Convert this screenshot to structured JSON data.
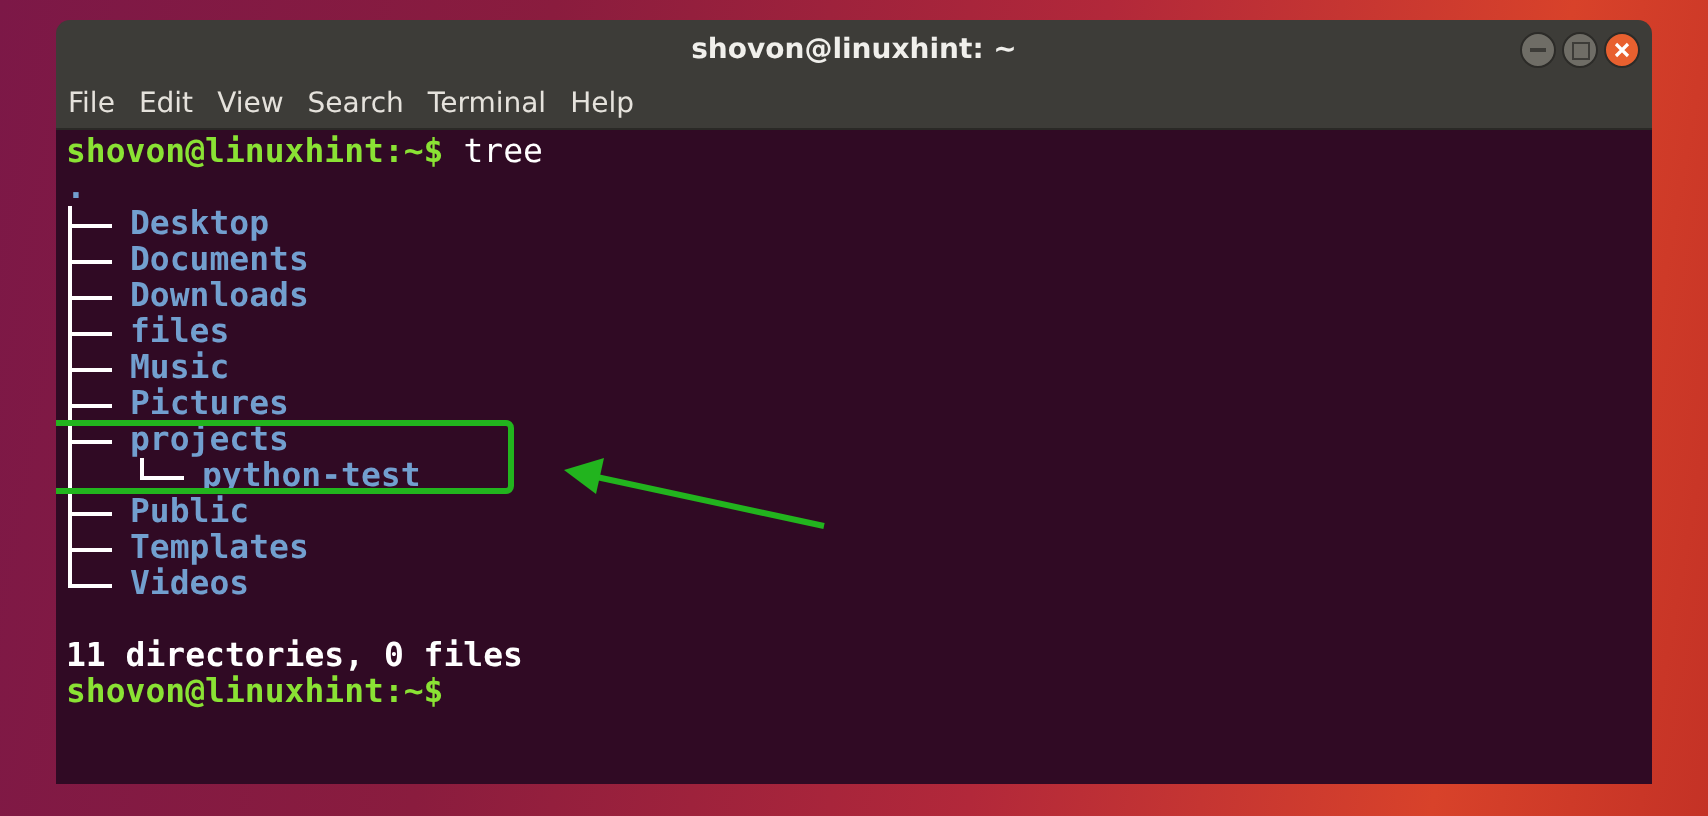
{
  "window": {
    "title": "shovon@linuxhint: ~"
  },
  "menu": [
    "File",
    "Edit",
    "View",
    "Search",
    "Terminal",
    "Help"
  ],
  "terminal": {
    "command_line": {
      "prompt": "shovon@linuxhint:~$",
      "command": "tree"
    },
    "tree": {
      "root": ".",
      "children": [
        {
          "name": "Desktop",
          "highlighted": false
        },
        {
          "name": "Documents",
          "highlighted": false
        },
        {
          "name": "Downloads",
          "highlighted": false
        },
        {
          "name": "files",
          "highlighted": false
        },
        {
          "name": "Music",
          "highlighted": false
        },
        {
          "name": "Pictures",
          "highlighted": false
        },
        {
          "name": "projects",
          "highlighted": true,
          "children": [
            {
              "name": "python-test"
            }
          ]
        },
        {
          "name": "Public",
          "highlighted": false
        },
        {
          "name": "Templates",
          "highlighted": false
        },
        {
          "name": "Videos",
          "highlighted": false
        }
      ]
    },
    "summary": "11 directories, 0 files",
    "final_prompt": "shovon@linuxhint:~$"
  }
}
